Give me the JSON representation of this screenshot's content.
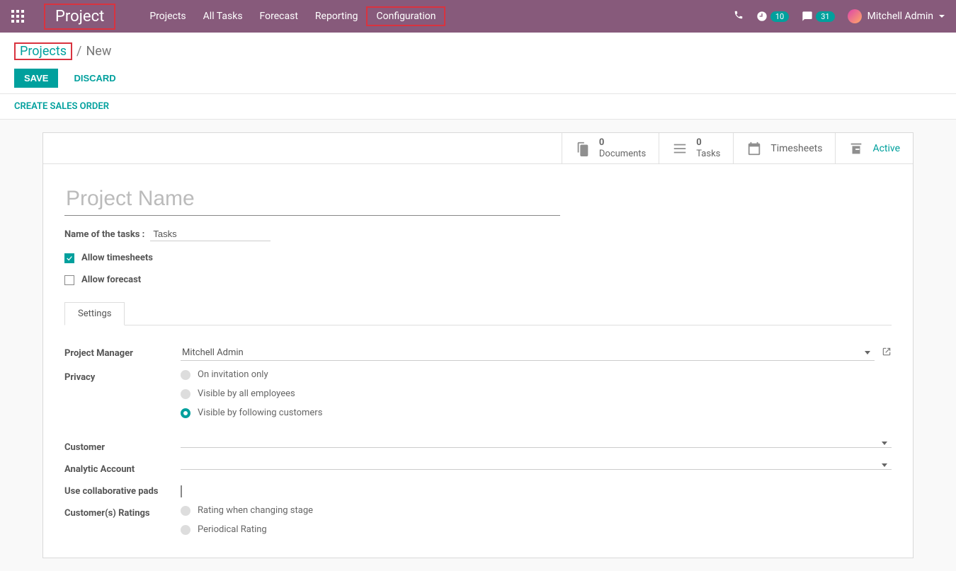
{
  "header": {
    "brand": "Project",
    "nav": [
      "Projects",
      "All Tasks",
      "Forecast",
      "Reporting",
      "Configuration"
    ],
    "clock_badge": "10",
    "chat_badge": "31",
    "user_name": "Mitchell Admin"
  },
  "breadcrumb": {
    "link": "Projects",
    "sep": "/",
    "current": "New"
  },
  "actions": {
    "save": "SAVE",
    "discard": "DISCARD"
  },
  "secondary": {
    "create_sales_order": "CREATE SALES ORDER"
  },
  "stats": {
    "documents_count": "0",
    "documents_label": "Documents",
    "tasks_count": "0",
    "tasks_label": "Tasks",
    "timesheets_label": "Timesheets",
    "active_label": "Active"
  },
  "form": {
    "project_name_placeholder": "Project Name",
    "task_name_label": "Name of the tasks :",
    "task_name_value": "Tasks",
    "allow_timesheets": "Allow timesheets",
    "allow_forecast": "Allow forecast",
    "tab_settings": "Settings",
    "settings": {
      "project_manager_label": "Project Manager",
      "project_manager_value": "Mitchell Admin",
      "privacy_label": "Privacy",
      "privacy_options": [
        "On invitation only",
        "Visible by all employees",
        "Visible by following customers"
      ],
      "customer_label": "Customer",
      "customer_value": "",
      "analytic_label": "Analytic Account",
      "analytic_value": "",
      "collab_label": "Use collaborative pads",
      "ratings_label": "Customer(s) Ratings",
      "ratings_options": [
        "Rating when changing stage",
        "Periodical Rating"
      ]
    }
  }
}
